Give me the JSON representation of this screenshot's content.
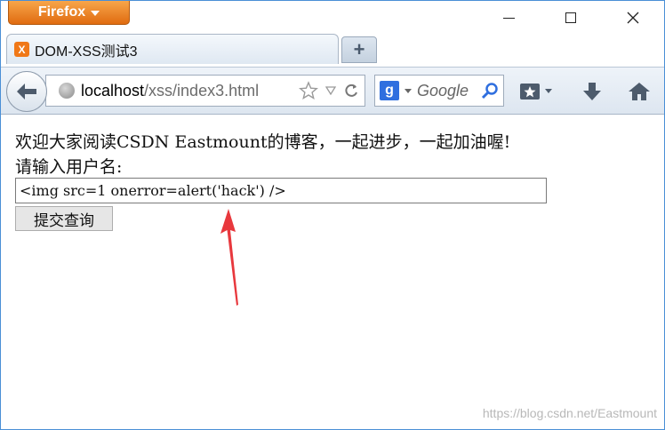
{
  "browser": {
    "menu_label": "Firefox",
    "window_controls": [
      "minimize",
      "maximize",
      "close"
    ]
  },
  "tab": {
    "favicon_letter": "X",
    "title": "DOM-XSS测试3",
    "new_tab_glyph": "+"
  },
  "navigation": {
    "url_host": "localhost",
    "url_path": "/xss/index3.html",
    "search_engine": "g",
    "search_placeholder": "Google"
  },
  "page": {
    "welcome_text": "欢迎大家阅读CSDN Eastmount的博客，一起进步，一起加油喔!",
    "prompt_label": "请输入用户名:",
    "input_value": "<img src=1 onerror=alert('hack') />",
    "submit_label": "提交查询"
  },
  "watermark": "https://blog.csdn.net/Eastmount",
  "colors": {
    "firefox_orange": "#e07a1f",
    "arrow_red": "#e8383d",
    "window_border": "#4a8fd6"
  },
  "icons": [
    "back-arrow-icon",
    "globe-icon",
    "star-icon",
    "dropdown-icon",
    "reload-icon",
    "google-icon",
    "search-icon",
    "bookmarks-icon",
    "download-icon",
    "home-icon",
    "annotation-arrow"
  ]
}
